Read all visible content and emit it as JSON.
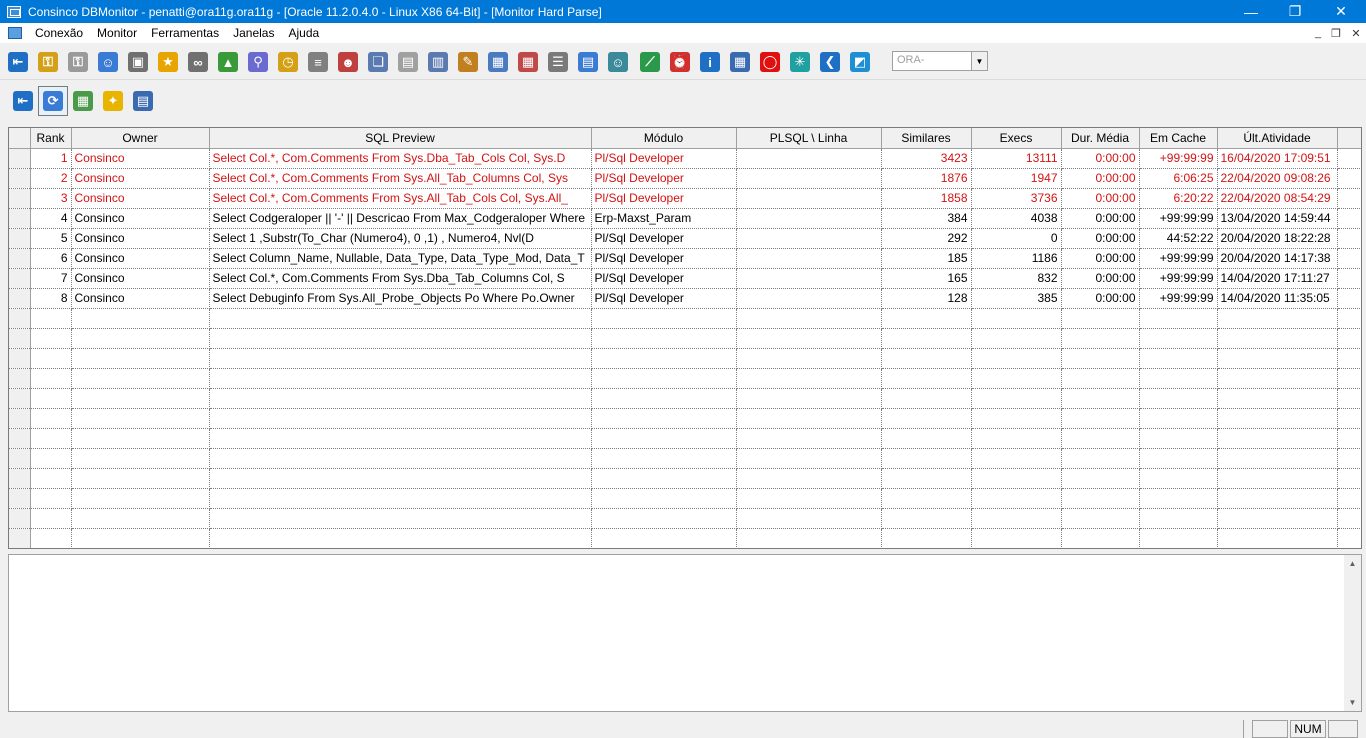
{
  "window": {
    "title": "Consinco DBMonitor - penatti@ora11g.ora11g - [Oracle 11.2.0.4.0 - Linux X86 64-Bit] - [Monitor Hard Parse]",
    "minimize_glyph": "—",
    "maximize_glyph": "❐",
    "close_glyph": "✕"
  },
  "menu": {
    "items": [
      {
        "label": "Conexão"
      },
      {
        "label": "Monitor"
      },
      {
        "label": "Ferramentas"
      },
      {
        "label": "Janelas"
      },
      {
        "label": "Ajuda"
      }
    ],
    "mdi_minimize_glyph": "_",
    "mdi_restore_glyph": "❐",
    "mdi_close_glyph": "✕"
  },
  "toolbar": {
    "buttons": [
      {
        "icon": "exit-door-icon",
        "glyph": "⇤",
        "color": "#1f6fc4"
      },
      {
        "icon": "key-icon",
        "glyph": "⚿",
        "color": "#d4a017"
      },
      {
        "icon": "key-gray-icon",
        "glyph": "⚿",
        "color": "#9a9a9a"
      },
      {
        "icon": "user-icon",
        "glyph": "☺",
        "color": "#3a7bd5"
      },
      {
        "icon": "lock-icon",
        "glyph": "▣",
        "color": "#707070"
      },
      {
        "icon": "star-icon",
        "glyph": "★",
        "color": "#e8a400"
      },
      {
        "icon": "binoculars-icon",
        "glyph": "∞",
        "color": "#707070"
      },
      {
        "icon": "chart-colors-icon",
        "glyph": "▲",
        "color": "#3a9a3a"
      },
      {
        "icon": "search-magnifier-icon",
        "glyph": "⚲",
        "color": "#6a6ad0"
      },
      {
        "icon": "clock-icon",
        "glyph": "◷",
        "color": "#d4a017"
      },
      {
        "icon": "database-icon",
        "glyph": "≡",
        "color": "#808080"
      },
      {
        "icon": "users-group-icon",
        "glyph": "☻",
        "color": "#c04040"
      },
      {
        "icon": "copy-pages-icon",
        "glyph": "❏",
        "color": "#5a7ab0"
      },
      {
        "icon": "document-icon",
        "glyph": "▤",
        "color": "#a0a0a0"
      },
      {
        "icon": "document-search-icon",
        "glyph": "▥",
        "color": "#5a7ab0"
      },
      {
        "icon": "document-edit-icon",
        "glyph": "✎",
        "color": "#c08020"
      },
      {
        "icon": "grid-blue-icon",
        "glyph": "▦",
        "color": "#4a7ac0"
      },
      {
        "icon": "grid-red-icon",
        "glyph": "▦",
        "color": "#c04a4a"
      },
      {
        "icon": "list-table-icon",
        "glyph": "☰",
        "color": "#7a7a7a"
      },
      {
        "icon": "monitor-list-icon",
        "glyph": "▤",
        "color": "#3a7bd5"
      },
      {
        "icon": "people-icon",
        "glyph": "☺",
        "color": "#3a8a9a"
      },
      {
        "icon": "line-chart-icon",
        "glyph": "⟋",
        "color": "#2a9a4a"
      },
      {
        "icon": "alarm-clock-icon",
        "glyph": "⏰",
        "color": "#d03030"
      },
      {
        "icon": "info-icon",
        "glyph": "i",
        "color": "#1f6fc4"
      },
      {
        "icon": "calculator-icon",
        "glyph": "▦",
        "color": "#3a6ab0"
      },
      {
        "icon": "oracle-icon",
        "glyph": "◯",
        "color": "#e01010"
      },
      {
        "icon": "asterisk-icon",
        "glyph": "✳",
        "color": "#20a0a0"
      },
      {
        "icon": "back-arrow-icon",
        "glyph": "❮",
        "color": "#1f6fc4"
      },
      {
        "icon": "book-icon",
        "glyph": "◩",
        "color": "#1f8fd4"
      }
    ],
    "connection_combo": {
      "value": "ORA-",
      "arrow": "▼"
    }
  },
  "toolbar2": {
    "buttons": [
      {
        "icon": "exit-door-icon",
        "glyph": "⇤",
        "color": "#1f6fc4",
        "pressed": false
      },
      {
        "icon": "refresh-icon",
        "glyph": "⟳",
        "color": "#3a7bd5",
        "pressed": true
      },
      {
        "icon": "calendar-grid-icon",
        "glyph": "▦",
        "color": "#4a9a4a",
        "pressed": false
      },
      {
        "icon": "lightbulb-icon",
        "glyph": "✦",
        "color": "#e8b400",
        "pressed": false
      },
      {
        "icon": "list-select-icon",
        "glyph": "▤",
        "color": "#3a6ab0",
        "pressed": false
      }
    ]
  },
  "grid": {
    "columns": [
      "Rank",
      "Owner",
      "SQL Preview",
      "Módulo",
      "PLSQL \\ Linha",
      "Similares",
      "Execs",
      "Dur. Média",
      "Em Cache",
      "Últ.Atividade"
    ],
    "rows": [
      {
        "rank": "1",
        "owner": "Consinco",
        "sql": "Select Col.*, Com.Comments From Sys.Dba_Tab_Cols Col,      Sys.D",
        "modulo": "Pl/Sql Developer",
        "plsql": "",
        "similares": "3423",
        "execs": "13111",
        "dur": "0:00:00",
        "cache": "+99:99:99",
        "ultima": "16/04/2020 17:09:51",
        "highlight": true
      },
      {
        "rank": "2",
        "owner": "Consinco",
        "sql": "Select Col.*, Com.Comments From Sys.All_Tab_Columns Col,      Sys",
        "modulo": "Pl/Sql Developer",
        "plsql": "",
        "similares": "1876",
        "execs": "1947",
        "dur": "0:00:00",
        "cache": "6:06:25",
        "ultima": "22/04/2020 09:08:26",
        "highlight": true
      },
      {
        "rank": "3",
        "owner": "Consinco",
        "sql": "Select Col.*, Com.Comments From Sys.All_Tab_Cols Col,      Sys.All_",
        "modulo": "Pl/Sql Developer",
        "plsql": "",
        "similares": "1858",
        "execs": "3736",
        "dur": "0:00:00",
        "cache": "6:20:22",
        "ultima": "22/04/2020 08:54:29",
        "highlight": true
      },
      {
        "rank": "4",
        "owner": "Consinco",
        "sql": "Select Codgeraloper || '-' || Descricao From Max_Codgeraloper  Where",
        "modulo": "Erp-Maxst_Param",
        "plsql": "",
        "similares": "384",
        "execs": "4038",
        "dur": "0:00:00",
        "cache": "+99:99:99",
        "ultima": "13/04/2020 14:59:44",
        "highlight": false
      },
      {
        "rank": "5",
        "owner": "Consinco",
        "sql": "Select   1 ,Substr(To_Char (Numero4), 0 ,1) ,  Numero4,            Nvl(D",
        "modulo": "Pl/Sql Developer",
        "plsql": "",
        "similares": "292",
        "execs": "0",
        "dur": "0:00:00",
        "cache": "44:52:22",
        "ultima": "20/04/2020 18:22:28",
        "highlight": false
      },
      {
        "rank": "6",
        "owner": "Consinco",
        "sql": "Select Column_Name, Nullable, Data_Type, Data_Type_Mod, Data_T",
        "modulo": "Pl/Sql Developer",
        "plsql": "",
        "similares": "185",
        "execs": "1186",
        "dur": "0:00:00",
        "cache": "+99:99:99",
        "ultima": "20/04/2020 14:17:38",
        "highlight": false
      },
      {
        "rank": "7",
        "owner": "Consinco",
        "sql": "Select Col.*, Com.Comments From Sys.Dba_Tab_Columns Col,     S",
        "modulo": "Pl/Sql Developer",
        "plsql": "",
        "similares": "165",
        "execs": "832",
        "dur": "0:00:00",
        "cache": "+99:99:99",
        "ultima": "14/04/2020 17:11:27",
        "highlight": false
      },
      {
        "rank": "8",
        "owner": "Consinco",
        "sql": "Select Debuginfo   From Sys.All_Probe_Objects Po  Where Po.Owner",
        "modulo": "Pl/Sql Developer",
        "plsql": "",
        "similares": "128",
        "execs": "385",
        "dur": "0:00:00",
        "cache": "+99:99:99",
        "ultima": "14/04/2020 11:35:05",
        "highlight": false
      }
    ]
  },
  "detail": {
    "text": "",
    "scroll_up": "▲",
    "scroll_down": "▼"
  },
  "statusbar": {
    "num": "NUM"
  }
}
